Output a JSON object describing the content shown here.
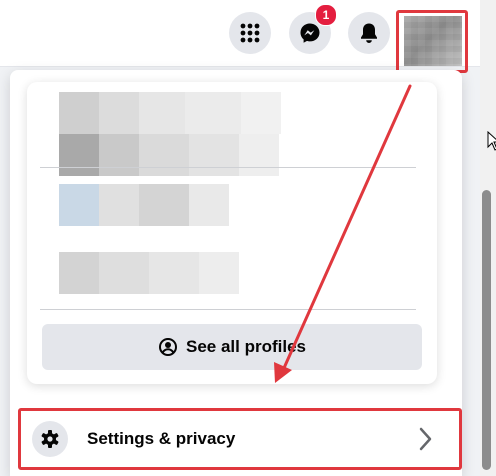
{
  "header": {
    "menu_icon": "grid-icon",
    "messenger_icon": "messenger-icon",
    "messenger_badge": "1",
    "notifications_icon": "bell-icon"
  },
  "profiles": {
    "see_all_label": "See all profiles",
    "see_all_icon": "user-circle-icon"
  },
  "menu": {
    "settings_label": "Settings & privacy",
    "settings_icon": "gear-icon",
    "settings_chevron": "chevron-right-icon"
  },
  "colors": {
    "accent_red": "#e0383e",
    "badge_red": "#e41e3f",
    "button_gray": "#e4e6eb"
  }
}
